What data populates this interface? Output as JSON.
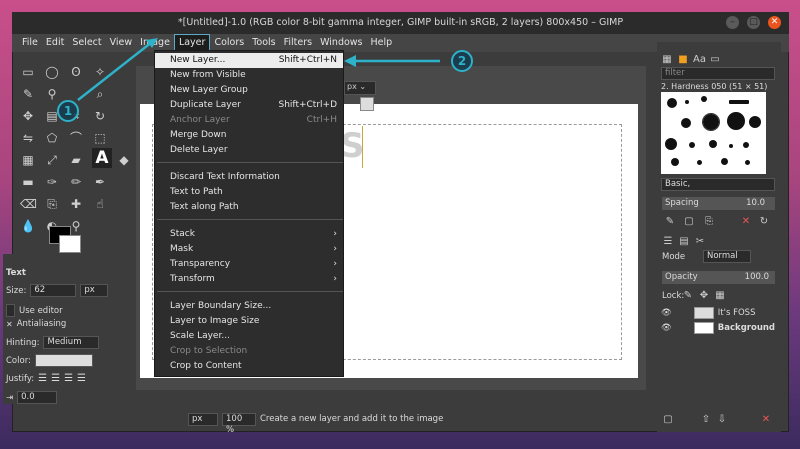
{
  "window": {
    "title": "*[Untitled]-1.0 (RGB color 8-bit gamma integer, GIMP built-in sRGB, 2 layers) 800x450 – GIMP"
  },
  "menubar": [
    "File",
    "Edit",
    "Select",
    "View",
    "Image",
    "Layer",
    "Colors",
    "Tools",
    "Filters",
    "Windows",
    "Help"
  ],
  "layer_menu": {
    "items": [
      {
        "label": "New Layer...",
        "shortcut": "Shift+Ctrl+N"
      },
      {
        "label": "New from Visible"
      },
      {
        "label": "New Layer Group"
      },
      {
        "label": "Duplicate Layer",
        "shortcut": "Shift+Ctrl+D"
      },
      {
        "label": "Anchor Layer",
        "shortcut": "Ctrl+H"
      },
      {
        "label": "Merge Down"
      },
      {
        "label": "Delete Layer"
      },
      {
        "label": "Discard Text Information"
      },
      {
        "label": "Text to Path"
      },
      {
        "label": "Text along Path"
      },
      {
        "label": "Stack"
      },
      {
        "label": "Mask"
      },
      {
        "label": "Transparency"
      },
      {
        "label": "Transform"
      },
      {
        "label": "Layer Boundary Size..."
      },
      {
        "label": "Layer to Image Size"
      },
      {
        "label": "Scale Layer..."
      },
      {
        "label": "Crop to Selection"
      },
      {
        "label": "Crop to Content"
      }
    ]
  },
  "tool_options": {
    "section": "Text",
    "size_label": "Size:",
    "size_value": "62",
    "size_unit": "px",
    "use_editor": "Use editor",
    "antialiasing": "Antialiasing",
    "hinting_label": "Hinting:",
    "hinting_value": "Medium",
    "color_label": "Color:",
    "justify_label": "Justify:",
    "indent_value": "0.0"
  },
  "canvas": {
    "text_fragment": "S"
  },
  "statusbar": {
    "unit": "px",
    "zoom": "100 %",
    "message": "Create a new layer and add it to the image"
  },
  "right_dock": {
    "filter_placeholder": "filter",
    "brush_name": "2. Hardness 050 (51 × 51)",
    "preset": "Basic,",
    "spacing_label": "Spacing",
    "spacing_value": "10.0",
    "mode_label": "Mode",
    "mode_value": "Normal",
    "opacity_label": "Opacity",
    "opacity_value": "100.0",
    "lock_label": "Lock:",
    "layers": [
      {
        "name": "It's FOSS"
      },
      {
        "name": "Background"
      }
    ]
  },
  "annotations": {
    "one": "1",
    "two": "2"
  },
  "colors": {
    "accent": "#2db2c9",
    "menu_highlight": "#ececec",
    "close_button": "#e9541f"
  }
}
